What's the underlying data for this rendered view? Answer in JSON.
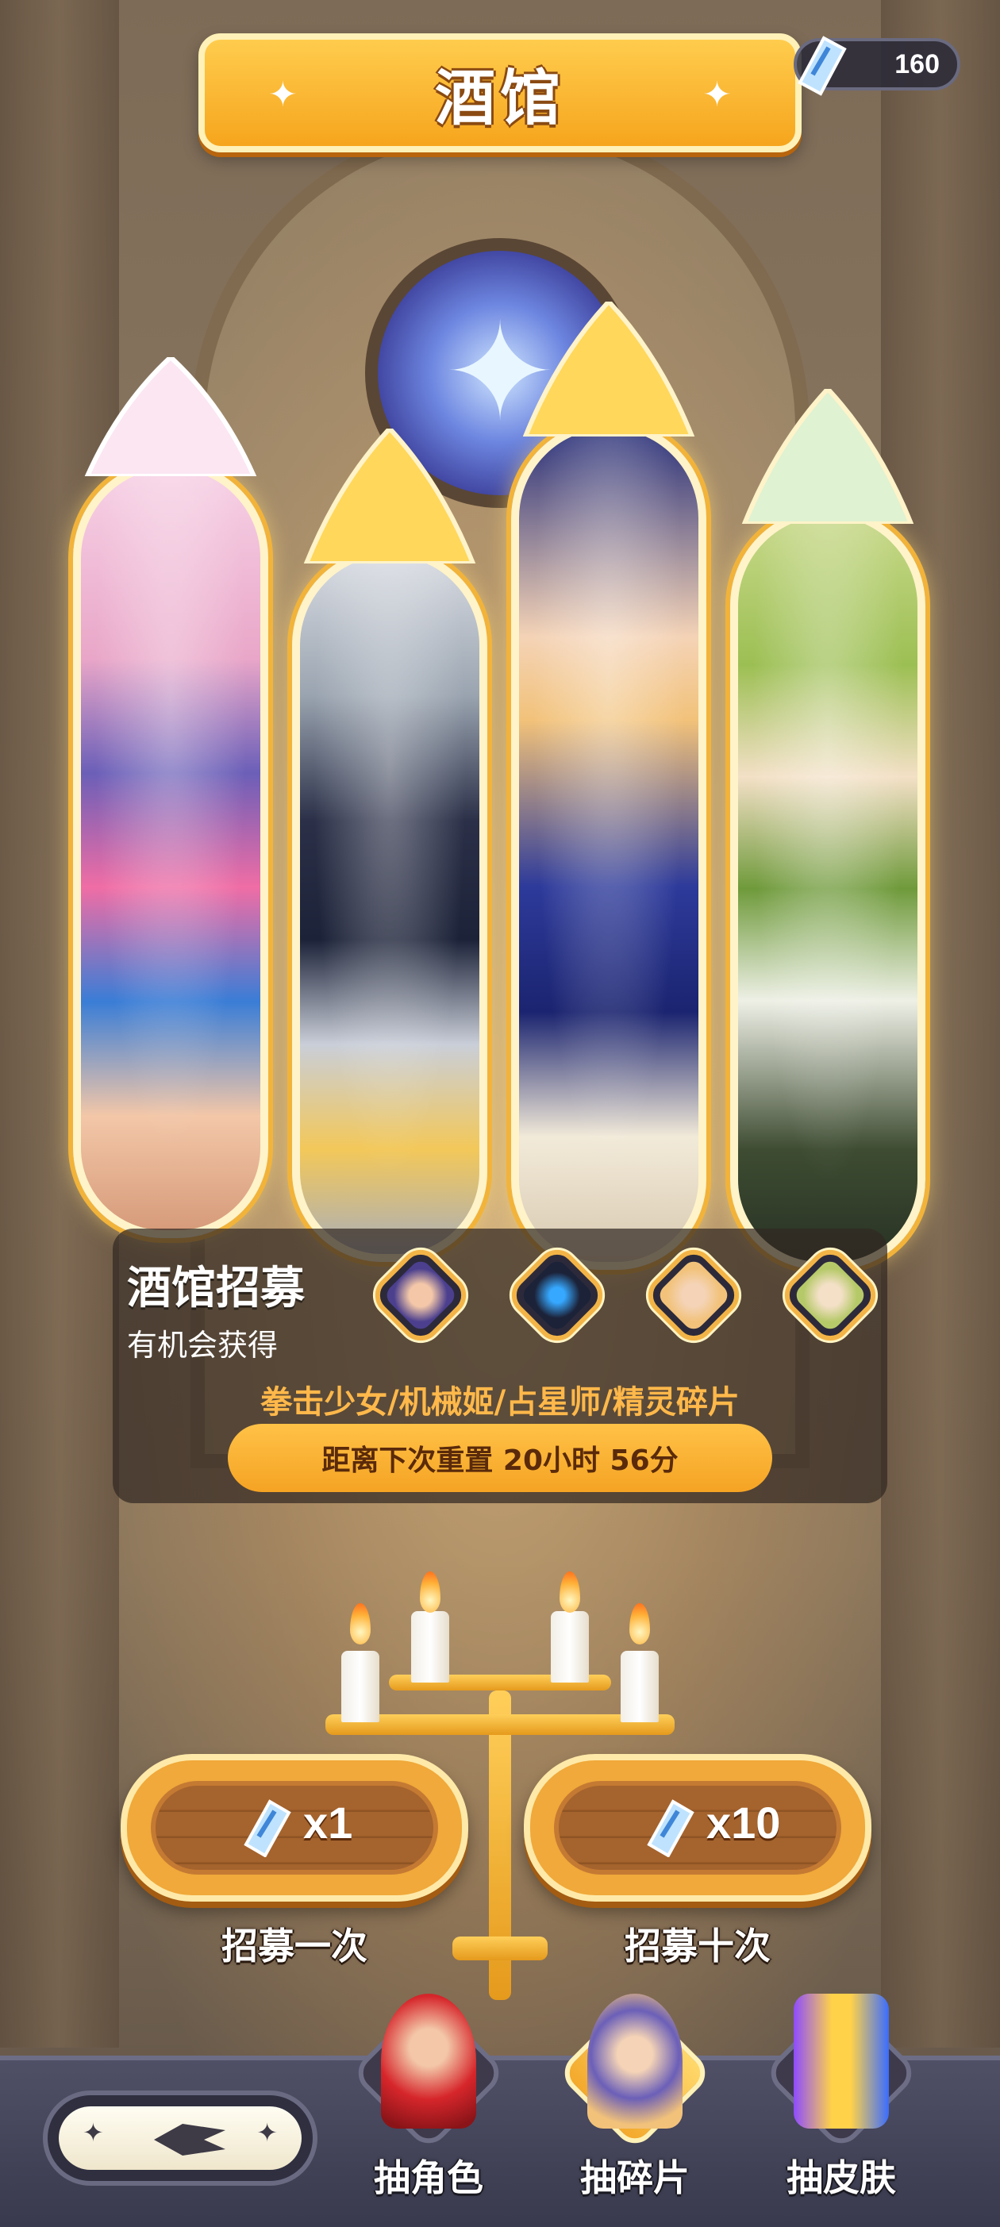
{
  "header": {
    "title": "酒馆",
    "ticket_count": "160",
    "ticket_icon": "ticket-icon"
  },
  "cards": [
    {
      "name": "拳击少女",
      "color": "#f06da5"
    },
    {
      "name": "机械姬",
      "color": "#2b3048"
    },
    {
      "name": "占星师",
      "color": "#2d3a9a"
    },
    {
      "name": "精灵",
      "color": "#9cbf53"
    }
  ],
  "info": {
    "title": "酒馆招募",
    "subtitle": "有机会获得",
    "names": "拳击少女/机械姬/占星师/精灵碎片",
    "reset": "距离下次重置 20小时 56分"
  },
  "recruit": {
    "single": {
      "mult": "x1",
      "label": "招募一次"
    },
    "ten": {
      "mult": "x10",
      "label": "招募十次"
    }
  },
  "tabs": [
    {
      "label": "抽角色",
      "icon": "character-icon"
    },
    {
      "label": "抽碎片",
      "icon": "fragment-icon"
    },
    {
      "label": "抽皮肤",
      "icon": "skin-icon"
    }
  ],
  "colors": {
    "accent": "#f6a51d",
    "names_text": "#ffb84a",
    "panel": "#322823"
  }
}
